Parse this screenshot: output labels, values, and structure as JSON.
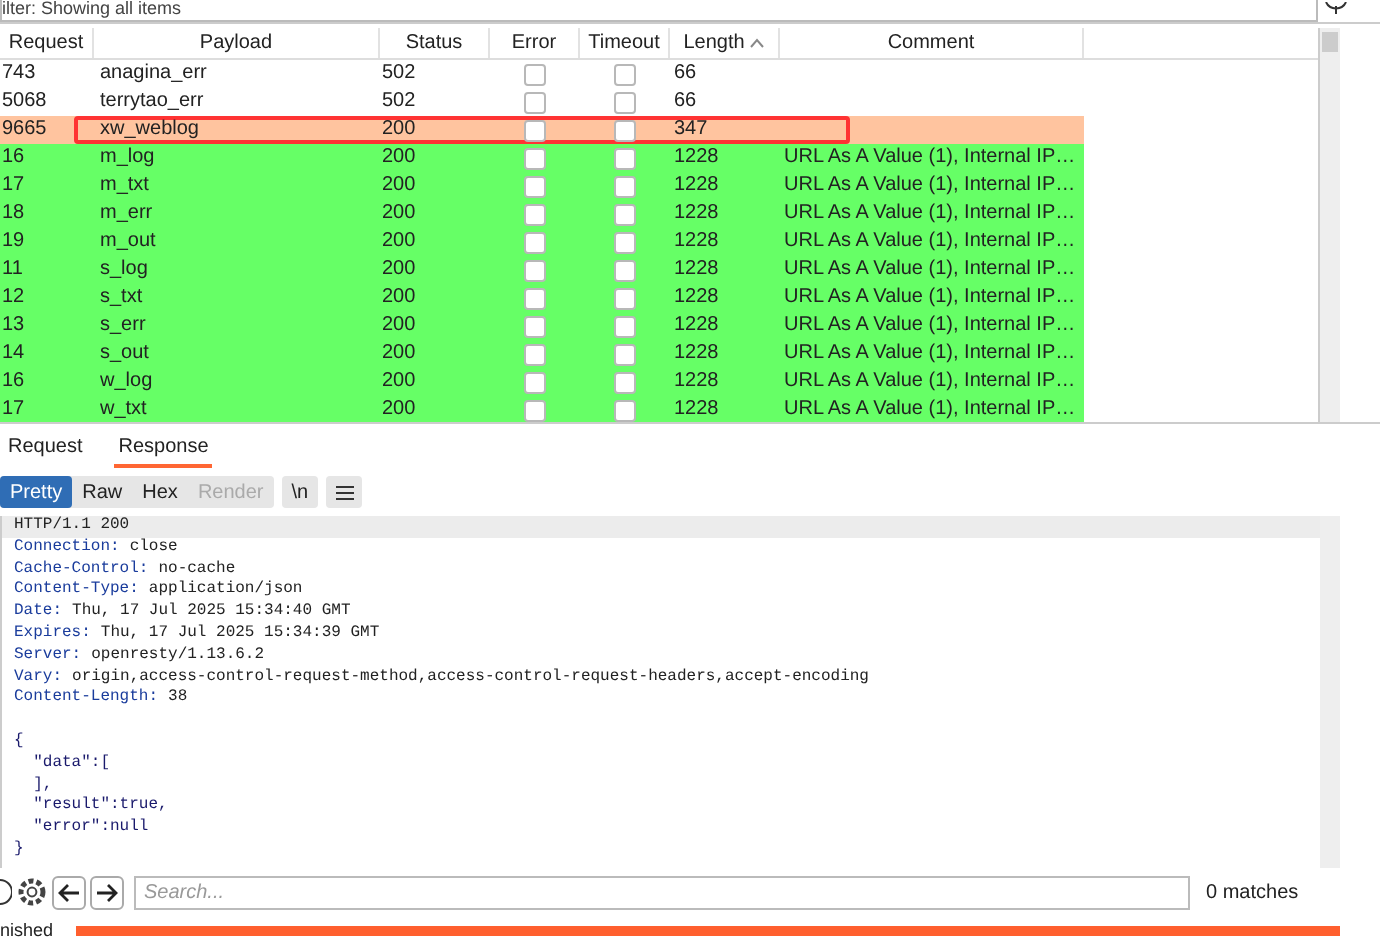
{
  "filter_bar": {
    "text": "ilter: Showing all items"
  },
  "table": {
    "columns": [
      {
        "label": "Request",
        "sorted": false
      },
      {
        "label": "Payload",
        "sorted": false
      },
      {
        "label": "Status",
        "sorted": false
      },
      {
        "label": "Error",
        "sorted": false
      },
      {
        "label": "Timeout",
        "sorted": false
      },
      {
        "label": "Length",
        "sorted": true
      },
      {
        "label": "Comment",
        "sorted": false
      }
    ],
    "rows": [
      {
        "request": "743",
        "payload": "anagina_err",
        "status": "502",
        "error": false,
        "timeout": false,
        "length": "66",
        "color": "#ffffff",
        "outlined": false
      },
      {
        "request": "5068",
        "payload": "terrytao_err",
        "status": "502",
        "error": false,
        "timeout": false,
        "length": "66",
        "color": "#ffffff",
        "outlined": false
      },
      {
        "request": "9665",
        "payload": "xw_weblog",
        "status": "200",
        "error": false,
        "timeout": false,
        "length": "347",
        "color": "#ffc49f",
        "outlined": true
      },
      {
        "request": "16",
        "payload": "m_log",
        "status": "200",
        "error": false,
        "timeout": false,
        "length": "1228",
        "comment": "URL As A Value (1), Internal IP…",
        "color": "#66ff66",
        "outlined": false
      },
      {
        "request": "17",
        "payload": "m_txt",
        "status": "200",
        "error": false,
        "timeout": false,
        "length": "1228",
        "comment": "URL As A Value (1), Internal IP…",
        "color": "#66ff66",
        "outlined": false
      },
      {
        "request": "18",
        "payload": "m_err",
        "status": "200",
        "error": false,
        "timeout": false,
        "length": "1228",
        "comment": "URL As A Value (1), Internal IP…",
        "color": "#66ff66",
        "outlined": false
      },
      {
        "request": "19",
        "payload": "m_out",
        "status": "200",
        "error": false,
        "timeout": false,
        "length": "1228",
        "comment": "URL As A Value (1), Internal IP…",
        "color": "#66ff66",
        "outlined": false
      },
      {
        "request": "11",
        "payload": "s_log",
        "status": "200",
        "error": false,
        "timeout": false,
        "length": "1228",
        "comment": "URL As A Value (1), Internal IP…",
        "color": "#66ff66",
        "outlined": false
      },
      {
        "request": "12",
        "payload": "s_txt",
        "status": "200",
        "error": false,
        "timeout": false,
        "length": "1228",
        "comment": "URL As A Value (1), Internal IP…",
        "color": "#66ff66",
        "outlined": false
      },
      {
        "request": "13",
        "payload": "s_err",
        "status": "200",
        "error": false,
        "timeout": false,
        "length": "1228",
        "comment": "URL As A Value (1), Internal IP…",
        "color": "#66ff66",
        "outlined": false
      },
      {
        "request": "14",
        "payload": "s_out",
        "status": "200",
        "error": false,
        "timeout": false,
        "length": "1228",
        "comment": "URL As A Value (1), Internal IP…",
        "color": "#66ff66",
        "outlined": false
      },
      {
        "request": "16",
        "payload": "w_log",
        "status": "200",
        "error": false,
        "timeout": false,
        "length": "1228",
        "comment": "URL As A Value (1), Internal IP…",
        "color": "#66ff66",
        "outlined": false
      },
      {
        "request": "17",
        "payload": "w_txt",
        "status": "200",
        "error": false,
        "timeout": false,
        "length": "1228",
        "comment": "URL As A Value (1), Internal IP…",
        "color": "#66ff66",
        "outlined": false
      }
    ]
  },
  "tabs": [
    {
      "label": "Request",
      "selected": false
    },
    {
      "label": "Response",
      "selected": true
    }
  ],
  "view_buttons": [
    {
      "label": "Pretty",
      "selected": true,
      "disabled": false
    },
    {
      "label": "Raw",
      "selected": false,
      "disabled": false
    },
    {
      "label": "Hex",
      "selected": false,
      "disabled": false
    },
    {
      "label": "Render",
      "selected": false,
      "disabled": true
    }
  ],
  "newline_button": "\\n",
  "response": {
    "lines": [
      {
        "kind": "status",
        "text": "HTTP/1.1 200"
      },
      {
        "kind": "header",
        "name": "Connection:",
        "value": "close"
      },
      {
        "kind": "header",
        "name": "Cache-Control:",
        "value": "no-cache"
      },
      {
        "kind": "header",
        "name": "Content-Type:",
        "value": "application/json"
      },
      {
        "kind": "header",
        "name": "Date:",
        "value": "Thu, 17 Jul 2025 15:34:40 GMT"
      },
      {
        "kind": "header",
        "name": "Expires:",
        "value": "Thu, 17 Jul 2025 15:34:39 GMT"
      },
      {
        "kind": "header",
        "name": "Server:",
        "value": "openresty/1.13.6.2"
      },
      {
        "kind": "header",
        "name": "Vary:",
        "value": "origin,access-control-request-method,access-control-request-headers,accept-encoding"
      },
      {
        "kind": "header",
        "name": "Content-Length:",
        "value": "38"
      },
      {
        "kind": "blank"
      },
      {
        "kind": "body",
        "text": "{"
      },
      {
        "kind": "body",
        "text": "  \"data\":["
      },
      {
        "kind": "body",
        "text": "  ],"
      },
      {
        "kind": "body",
        "text": "  \"result\":true,"
      },
      {
        "kind": "body",
        "text": "  \"error\":null"
      },
      {
        "kind": "body",
        "text": "}"
      }
    ]
  },
  "search": {
    "placeholder": "Search...",
    "matches": "0 matches"
  },
  "status_bar": {
    "text": "nished",
    "level": 1
  }
}
